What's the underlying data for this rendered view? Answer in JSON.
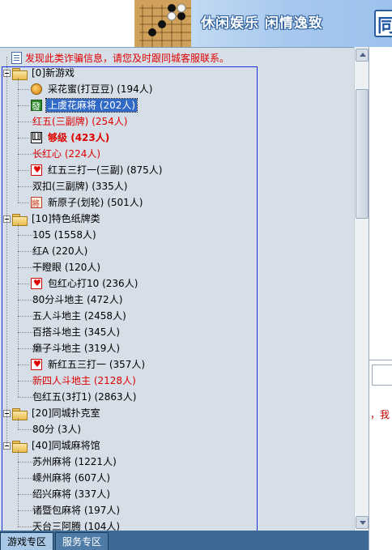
{
  "banner": {
    "slogan": "休闲娱乐 闲情逸致",
    "edge_char": "同"
  },
  "notice": "发现此类诈骗信息，请您及时跟同城客服联系。",
  "tree": {
    "categories": [
      {
        "label": "[0]新游戏",
        "games": [
          {
            "label": "采花蜜(打豆豆)",
            "count": "(194人)",
            "icon": "bean-icon",
            "color": "normal"
          },
          {
            "label": "上虞花麻将",
            "count": "(202人)",
            "icon": "mahjong-tile-icon",
            "color": "selected"
          },
          {
            "label": "红五(三副牌)",
            "count": "(254人)",
            "icon": "",
            "color": "red"
          },
          {
            "label": "够级",
            "count": "(423人)",
            "icon": "dice-icon",
            "color": "red-bold"
          },
          {
            "label": "长红心",
            "count": "(224人)",
            "icon": "",
            "color": "red"
          },
          {
            "label": "红五三打一(三副)",
            "count": "(875人)",
            "icon": "heart-card-icon",
            "color": "normal"
          },
          {
            "label": "双扣(三副牌)",
            "count": "(335人)",
            "icon": "",
            "color": "normal"
          },
          {
            "label": "新原子(划轮)",
            "count": "(501人)",
            "icon": "chinese-tile-icon",
            "color": "normal"
          }
        ]
      },
      {
        "label": "[10]特色纸牌类",
        "games": [
          {
            "label": "105",
            "count": "(1558人)",
            "icon": "",
            "color": "normal"
          },
          {
            "label": "红A",
            "count": "(220人)",
            "icon": "",
            "color": "normal"
          },
          {
            "label": "干瞪眼",
            "count": "(120人)",
            "icon": "",
            "color": "normal"
          },
          {
            "label": "包红心打10",
            "count": "(236人)",
            "icon": "heart-card-icon",
            "color": "normal"
          },
          {
            "label": "80分斗地主",
            "count": "(472人)",
            "icon": "",
            "color": "normal"
          },
          {
            "label": "五人斗地主",
            "count": "(2458人)",
            "icon": "",
            "color": "normal"
          },
          {
            "label": "百搭斗地主",
            "count": "(345人)",
            "icon": "",
            "color": "normal"
          },
          {
            "label": "癞子斗地主",
            "count": "(319人)",
            "icon": "",
            "color": "normal"
          },
          {
            "label": "新红五三打一",
            "count": "(357人)",
            "icon": "heart-card-icon",
            "color": "normal"
          },
          {
            "label": "新四人斗地主",
            "count": "(2128人)",
            "icon": "",
            "color": "red"
          },
          {
            "label": "包红五(3打1)",
            "count": "(2863人)",
            "icon": "",
            "color": "normal"
          }
        ]
      },
      {
        "label": "[20]同城扑克室",
        "games": [
          {
            "label": "80分",
            "count": "(3人)",
            "icon": "",
            "color": "normal"
          }
        ]
      },
      {
        "label": "[40]同城麻将馆",
        "games": [
          {
            "label": "苏州麻将",
            "count": "(1221人)",
            "icon": "",
            "color": "normal"
          },
          {
            "label": "嵊州麻将",
            "count": "(607人)",
            "icon": "",
            "color": "normal"
          },
          {
            "label": "绍兴麻将",
            "count": "(337人)",
            "icon": "",
            "color": "normal"
          },
          {
            "label": "诸暨包麻将",
            "count": "(197人)",
            "icon": "",
            "color": "normal"
          },
          {
            "label": "天台三阿腾",
            "count": "(104人)",
            "icon": "",
            "color": "normal"
          }
        ]
      }
    ]
  },
  "right_pane": {
    "snippet": "，我"
  },
  "tabs": [
    {
      "label": "游戏专区",
      "active": true
    },
    {
      "label": "服务专区",
      "active": false
    }
  ],
  "colors": {
    "tree_bg": "#d6dee7",
    "accent_red": "#e00000",
    "selection": "#3169c6",
    "tab_bar": "#3c6a94"
  }
}
